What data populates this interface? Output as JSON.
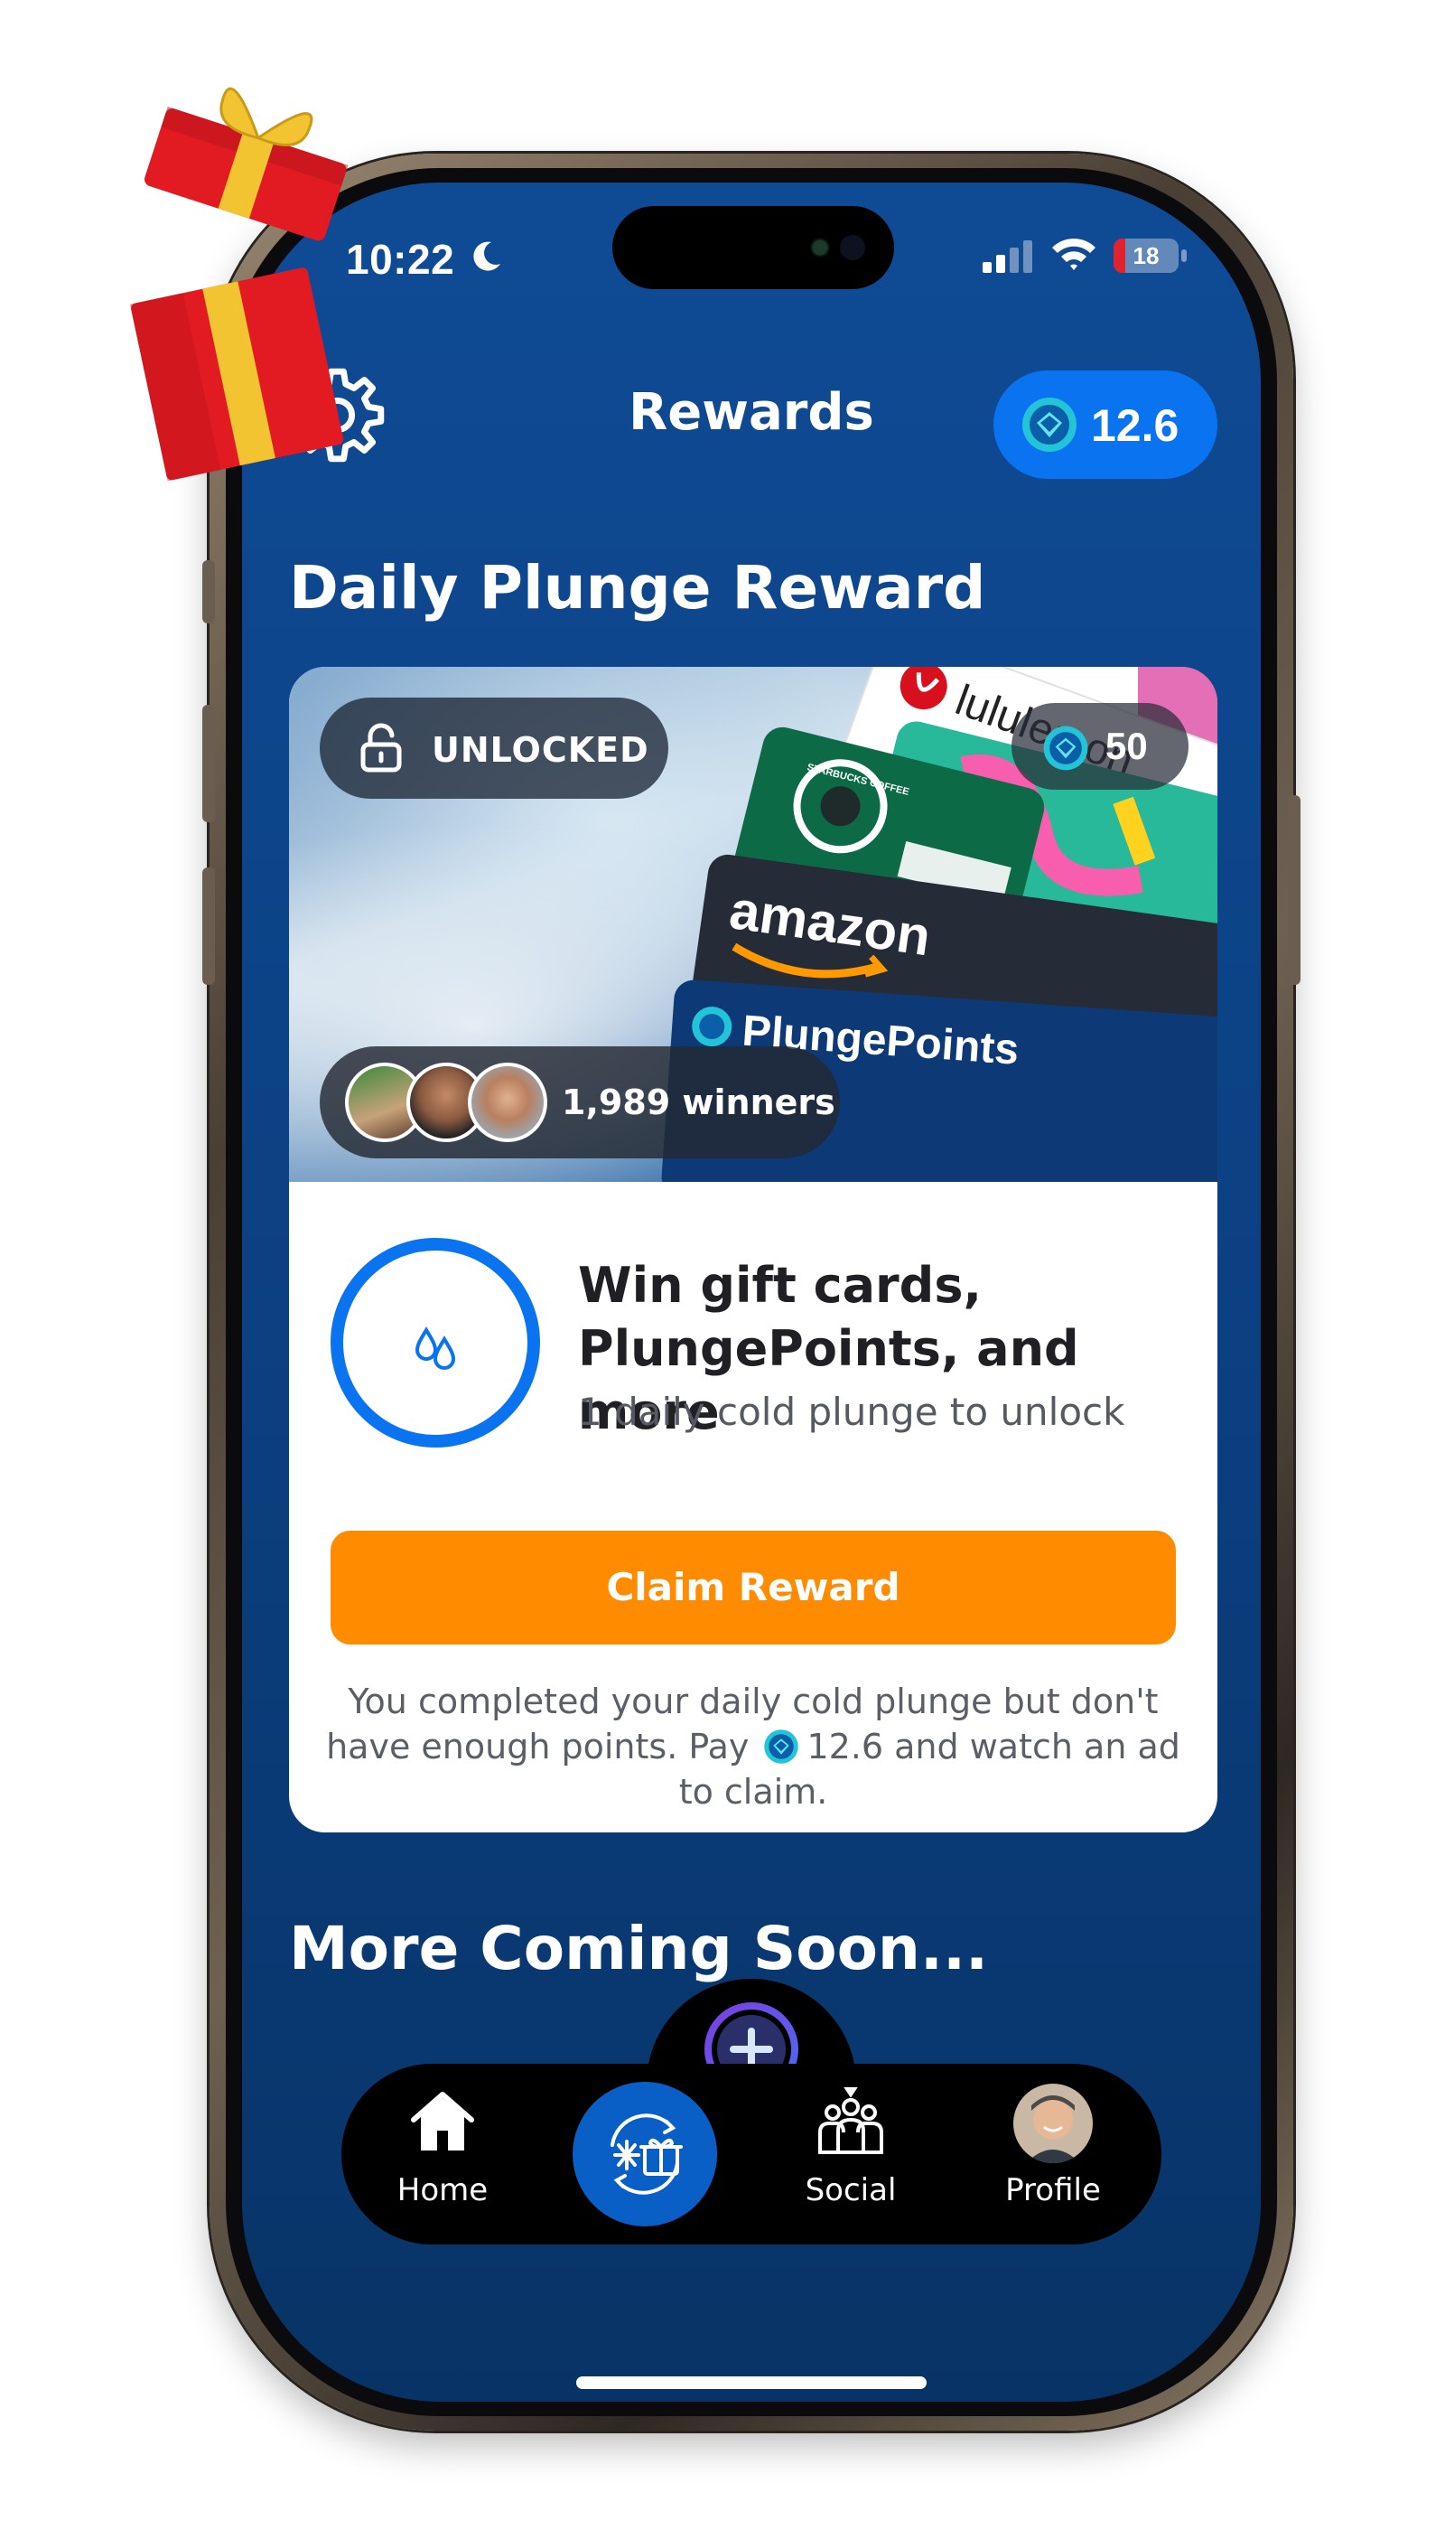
{
  "status_bar": {
    "time": "10:22",
    "battery": "18",
    "battery_level": 0.18
  },
  "header": {
    "title": "Rewards",
    "points_balance": "12.6"
  },
  "daily_reward": {
    "section_title": "Daily Plunge Reward",
    "status_badge": "UNLOCKED",
    "cost": "50",
    "winners": "1,989 winners",
    "brand_cards": [
      "lululemon",
      "STARBUCKS COFFEE",
      "amazon",
      "PlungePoints"
    ],
    "promo_title": "Win gift cards, PlungePoints, and more",
    "promo_subtitle": "1 daily cold plunge to unlock",
    "claim_label": "Claim Reward",
    "note_before": "You completed your daily cold plunge but don't have enough points. Pay",
    "note_amount": "12.6",
    "note_after": "and watch an ad to claim."
  },
  "coming_soon": {
    "title": "More Coming Soon..."
  },
  "tab_bar": {
    "items": [
      {
        "label": "Home",
        "icon": "house-icon"
      },
      {
        "label": "",
        "icon": "snowflake-gift-icon"
      },
      {
        "label": "Social",
        "icon": "group-icon"
      },
      {
        "label": "Profile",
        "icon": "avatar"
      }
    ]
  },
  "colors": {
    "background": "#0f4b95",
    "accent_blue": "#0a74f0",
    "claim_orange": "#ff8c00",
    "battery_red": "#e2222d"
  }
}
